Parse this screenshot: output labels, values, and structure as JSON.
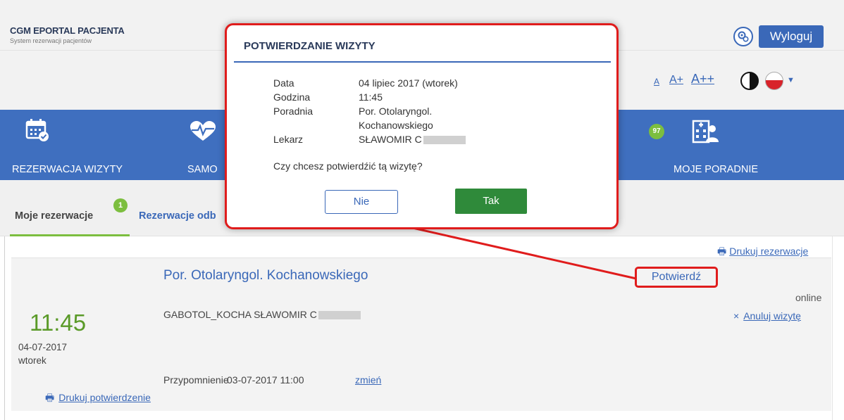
{
  "header": {
    "brand_title": "CGM EPORTAL PACJENTA",
    "brand_subtitle": "System rezerwacji pacjentów",
    "logout_label": "Wyloguj",
    "settings_icon": "settings-icon"
  },
  "accessibility": {
    "font_small": "A",
    "font_medium": "A+",
    "font_large": "A++",
    "contrast_icon": "contrast-icon",
    "language_flag": "pl-flag-icon",
    "language_caret": "▼"
  },
  "nav": {
    "items": [
      {
        "label": "REZERWACJA WIZYTY",
        "icon": "calendar-check-icon"
      },
      {
        "label": "SAMO",
        "icon": "heartbeat-icon"
      },
      {
        "label": "MOJE PORADNIE",
        "icon": "hospital-icon",
        "badge": "97"
      }
    ]
  },
  "tabs": {
    "mine_label": "Moje rezerwacje",
    "mine_badge": "1",
    "other_label": "Rezerwacje odb"
  },
  "print_reservations_label": "Drukuj rezerwacje",
  "reservation": {
    "clinic": "Por. Otolaryngol. Kochanowskiego",
    "time": "11:45",
    "date": "04-07-2017",
    "weekday": "wtorek",
    "doctor": "GABOTOL_KOCHA SŁAWOMIR C",
    "reminder_label": "Przypomnienie",
    "reminder_value": "03-07-2017 11:00",
    "reminder_change": " zmień",
    "print_confirmation_label": "Drukuj potwierdzenie",
    "status": "online",
    "cancel_icon": "×",
    "cancel_label": "Anuluj wizytę",
    "confirm_label": "Potwierdź"
  },
  "dialog": {
    "title": "POTWIERDZANIE WIZYTY",
    "rows": [
      {
        "key": "Data",
        "value": "04 lipiec 2017 (wtorek)"
      },
      {
        "key": "Godzina",
        "value": "11:45"
      },
      {
        "key": "Poradnia",
        "value": "Por. Otolaryngol."
      },
      {
        "key": "",
        "value": "Kochanowskiego"
      },
      {
        "key": "Lekarz",
        "value": "SŁAWOMIR C"
      }
    ],
    "question": "Czy chcesz potwierdźić tą wizytę?",
    "no_label": "Nie",
    "yes_label": "Tak"
  },
  "colors": {
    "accent": "#3f6fbf",
    "link": "#3a68b8",
    "success": "#2f8a3a",
    "badge": "#7cbe3f",
    "highlight": "#e01c1c"
  }
}
